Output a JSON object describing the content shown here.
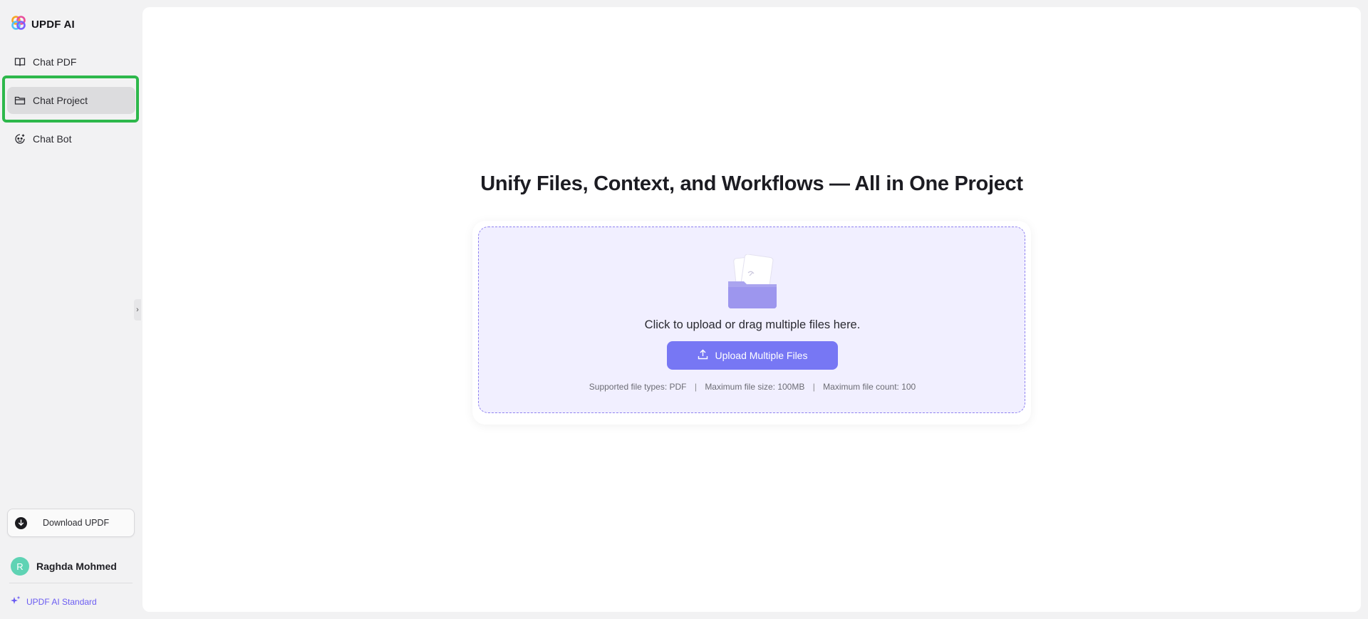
{
  "app": {
    "name": "UPDF AI"
  },
  "sidebar": {
    "items": [
      {
        "label": "Chat PDF",
        "icon": "book-open-icon",
        "active": false
      },
      {
        "label": "Chat Project",
        "icon": "folder-icon",
        "active": true
      },
      {
        "label": "Chat Bot",
        "icon": "bot-icon",
        "active": false
      }
    ],
    "download_label": "Download UPDF",
    "user": {
      "initial": "R",
      "name": "Raghda Mohmed"
    },
    "plan_label": "UPDF AI Standard"
  },
  "main": {
    "headline": "Unify Files, Context, and Workflows — All in One Project",
    "dropzone": {
      "prompt": "Click to upload or drag multiple files here.",
      "button_label": "Upload Multiple Files",
      "info": {
        "types": "Supported file types: PDF",
        "size": "Maximum file size: 100MB",
        "count": "Maximum file count: 100"
      }
    }
  },
  "colors": {
    "accent": "#7777f4",
    "annotation_highlight": "#2db84b",
    "avatar": "#5fd3b4",
    "plan": "#6b5cf2"
  }
}
